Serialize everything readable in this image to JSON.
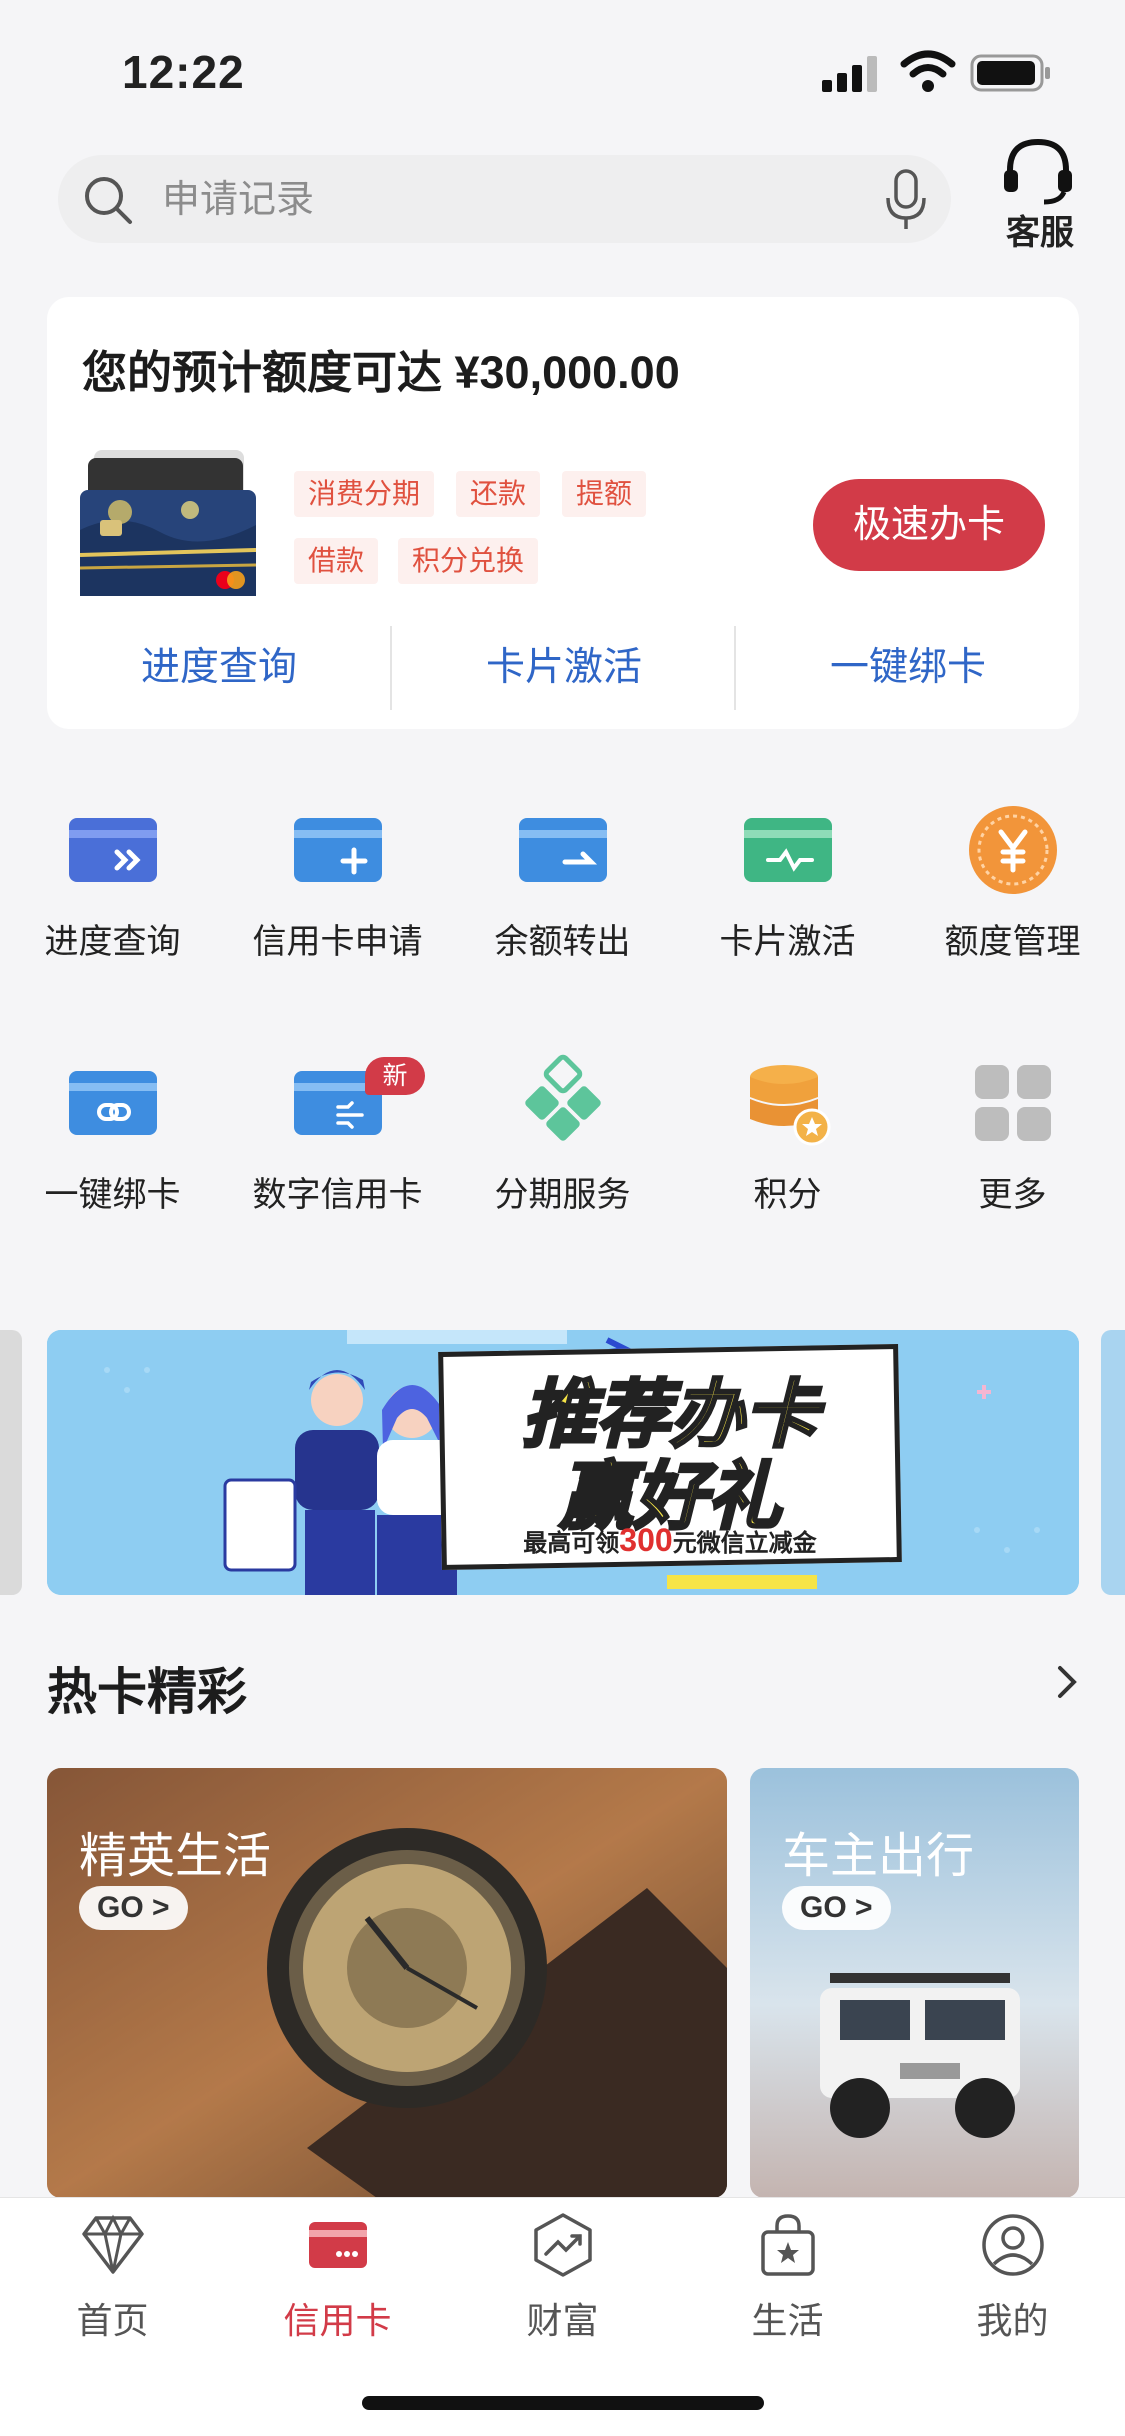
{
  "status_bar": {
    "time": "12:22"
  },
  "search": {
    "placeholder": "申请记录"
  },
  "header": {
    "customer_service_label": "客服"
  },
  "limit_card": {
    "title": "您的预计额度可达 ¥30,000.00",
    "tags": [
      "消费分期",
      "还款",
      "提额",
      "借款",
      "积分兑换"
    ],
    "apply_button": "极速办卡",
    "quick_links": [
      "进度查询",
      "卡片激活",
      "一键绑卡"
    ]
  },
  "services": {
    "row1": [
      {
        "label": "进度查询",
        "icon": "progress-card-icon"
      },
      {
        "label": "信用卡申请",
        "icon": "card-apply-icon"
      },
      {
        "label": "余额转出",
        "icon": "balance-transfer-icon"
      },
      {
        "label": "卡片激活",
        "icon": "card-activate-icon"
      },
      {
        "label": "额度管理",
        "icon": "limit-yen-icon"
      }
    ],
    "row2": [
      {
        "label": "一键绑卡",
        "icon": "card-bind-icon"
      },
      {
        "label": "数字信用卡",
        "icon": "digital-card-icon"
      },
      {
        "label": "分期服务",
        "icon": "installment-icon"
      },
      {
        "label": "积分",
        "icon": "points-icon"
      },
      {
        "label": "更多",
        "icon": "more-grid-icon"
      }
    ],
    "new_badge": "新"
  },
  "banner": {
    "line1": "推荐办卡",
    "line2": "赢好礼",
    "sub_prefix": "最高可领",
    "sub_amount": "300",
    "sub_suffix": "元微信立减金"
  },
  "hot_cards": {
    "section_title": "热卡精彩",
    "cards": [
      {
        "title": "精英生活",
        "go": "GO >"
      },
      {
        "title": "车主出行",
        "go": "GO >"
      }
    ]
  },
  "tabbar": {
    "tabs": [
      {
        "label": "首页",
        "icon": "diamond-icon"
      },
      {
        "label": "信用卡",
        "icon": "credit-card-icon",
        "active": true
      },
      {
        "label": "财富",
        "icon": "wealth-chart-icon"
      },
      {
        "label": "生活",
        "icon": "shopping-bag-icon"
      },
      {
        "label": "我的",
        "icon": "profile-icon"
      }
    ]
  },
  "colors": {
    "accent": "#d23b48",
    "link": "#2f66c7",
    "tag_text": "#e0513f"
  }
}
